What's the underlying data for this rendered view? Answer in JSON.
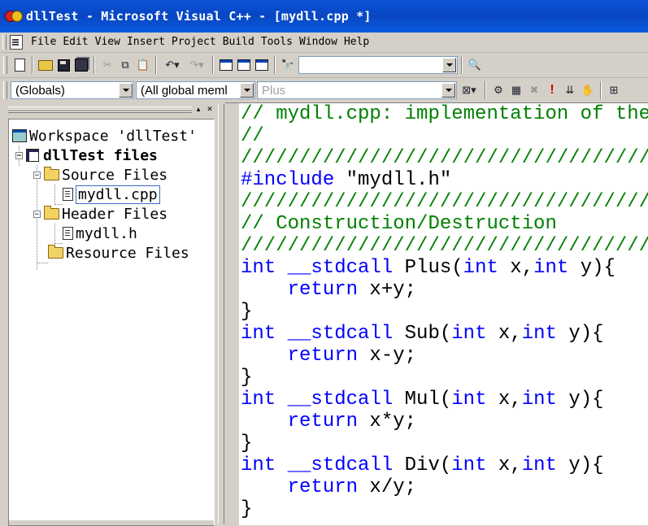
{
  "window": {
    "title": "dllTest - Microsoft Visual C++ - [mydll.cpp *]"
  },
  "menu": [
    "File",
    "Edit",
    "View",
    "Insert",
    "Project",
    "Build",
    "Tools",
    "Window",
    "Help"
  ],
  "toolbar": {
    "find_value": "",
    "scope": "(Globals)",
    "members": "(All global meml",
    "function": "Plus"
  },
  "workspace": {
    "root": "Workspace 'dllTest'",
    "project": "dllTest files",
    "source_folder": "Source Files",
    "source_file": "mydll.cpp",
    "header_folder": "Header Files",
    "header_file": "mydll.h",
    "resource_folder": "Resource Files"
  },
  "code_lines": [
    [
      [
        "cmt",
        "// mydll.cpp: implementation of the"
      ]
    ],
    [
      [
        "cmt",
        "//"
      ]
    ],
    [
      [
        "cmt",
        "////////////////////////////////////////"
      ]
    ],
    [
      [
        "kw",
        "#include"
      ],
      [
        "pl",
        " \"mydll.h\""
      ]
    ],
    [
      [
        "cmt",
        "////////////////////////////////////////"
      ]
    ],
    [
      [
        "cmt",
        "// Construction/Destruction"
      ]
    ],
    [
      [
        "cmt",
        "////////////////////////////////////////"
      ]
    ],
    [
      [
        "kw",
        "int"
      ],
      [
        "pl",
        " "
      ],
      [
        "kw",
        "__stdcall"
      ],
      [
        "pl",
        " Plus("
      ],
      [
        "kw",
        "int"
      ],
      [
        "pl",
        " x,"
      ],
      [
        "kw",
        "int"
      ],
      [
        "pl",
        " y){"
      ]
    ],
    [
      [
        "pl",
        "    "
      ],
      [
        "kw",
        "return"
      ],
      [
        "pl",
        " x+y;"
      ]
    ],
    [
      [
        "pl",
        "}"
      ]
    ],
    [
      [
        "kw",
        "int"
      ],
      [
        "pl",
        " "
      ],
      [
        "kw",
        "__stdcall"
      ],
      [
        "pl",
        " Sub("
      ],
      [
        "kw",
        "int"
      ],
      [
        "pl",
        " x,"
      ],
      [
        "kw",
        "int"
      ],
      [
        "pl",
        " y){"
      ]
    ],
    [
      [
        "pl",
        "    "
      ],
      [
        "kw",
        "return"
      ],
      [
        "pl",
        " x-y;"
      ]
    ],
    [
      [
        "pl",
        "}"
      ]
    ],
    [
      [
        "kw",
        "int"
      ],
      [
        "pl",
        " "
      ],
      [
        "kw",
        "__stdcall"
      ],
      [
        "pl",
        " Mul("
      ],
      [
        "kw",
        "int"
      ],
      [
        "pl",
        " x,"
      ],
      [
        "kw",
        "int"
      ],
      [
        "pl",
        " y){"
      ]
    ],
    [
      [
        "pl",
        "    "
      ],
      [
        "kw",
        "return"
      ],
      [
        "pl",
        " x*y;"
      ]
    ],
    [
      [
        "pl",
        "}"
      ]
    ],
    [
      [
        "kw",
        "int"
      ],
      [
        "pl",
        " "
      ],
      [
        "kw",
        "__stdcall"
      ],
      [
        "pl",
        " Div("
      ],
      [
        "kw",
        "int"
      ],
      [
        "pl",
        " x,"
      ],
      [
        "kw",
        "int"
      ],
      [
        "pl",
        " y){"
      ]
    ],
    [
      [
        "pl",
        "    "
      ],
      [
        "kw",
        "return"
      ],
      [
        "pl",
        " x/y;"
      ]
    ],
    [
      [
        "pl",
        "}"
      ]
    ]
  ],
  "colors": {
    "comment": "#008000",
    "keyword": "#0000ff",
    "titlebar": "#0a52d8"
  }
}
